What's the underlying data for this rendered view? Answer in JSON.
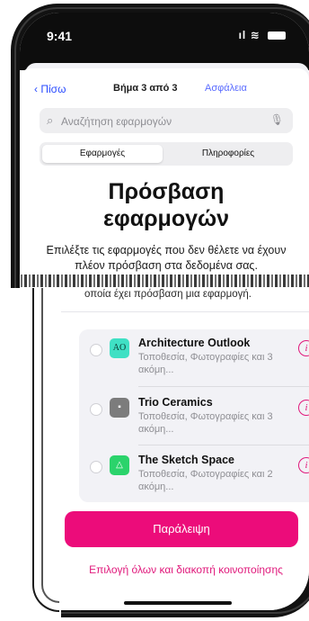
{
  "status_bar": {
    "time": "9:41",
    "signal": "ıl",
    "wifi": "≋"
  },
  "nav": {
    "back_label": "Πίσω",
    "title": "Βήμα 3 από 3",
    "right_label": "Ασφάλεια"
  },
  "search": {
    "placeholder": "Αναζήτηση εφαρμογών"
  },
  "segments": {
    "active": "Εφαρμογές",
    "other": "Πληροφορίες"
  },
  "page": {
    "title_line1": "Πρόσβαση",
    "title_line2": "εφαρμογών",
    "description": "Επιλέξτε τις εφαρμογές που δεν θέλετε να έχουν πλέον πρόσβαση στα δεδομένα σας.",
    "description2": "οποία έχει πρόσβαση μια εφαρμογή."
  },
  "apps": [
    {
      "name": "Architecture Outlook",
      "sub": "Τοποθεσία, Φωτογραφίες και 3 ακόμη...",
      "icon_text": "AO",
      "icon_color": "#3fe0c4"
    },
    {
      "name": "Trio Ceramics",
      "sub": "Τοποθεσία, Φωτογραφίες και 3 ακόμη...",
      "icon_text": "▪",
      "icon_color": "#8a8a8a"
    },
    {
      "name": "The Sketch Space",
      "sub": "Τοποθεσία, Φωτογραφίες και 2 ακόμη...",
      "icon_text": "△",
      "icon_color": "#2bd36b"
    }
  ],
  "buttons": {
    "primary": "Παράλειψη",
    "secondary": "Επιλογή όλων και διακοπή κοινοποίησης"
  },
  "colors": {
    "accent": "#ec0c7a",
    "link": "#2a4cff"
  }
}
